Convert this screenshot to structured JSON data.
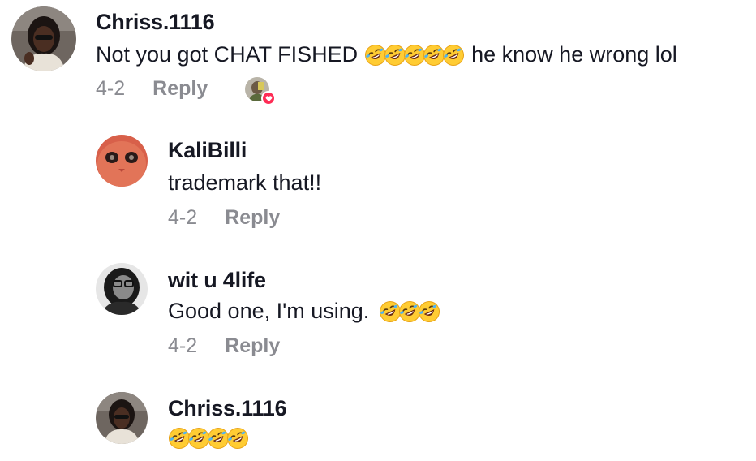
{
  "comments": [
    {
      "username": "Chriss.1116",
      "text": "Not you got CHAT FISHED",
      "emoji_count": 5,
      "text_after": "he know he wrong lol",
      "date": "4-2",
      "reply_label": "Reply"
    },
    {
      "username": "KaliBilli",
      "text": "trademark that!!",
      "date": "4-2",
      "reply_label": "Reply"
    },
    {
      "username": "wit u 4life",
      "text": "Good one, I'm using.",
      "emoji_count": 3,
      "date": "4-2",
      "reply_label": "Reply"
    },
    {
      "username": "Chriss.1116",
      "emoji_count": 4
    }
  ],
  "icons": {
    "emoji": "rolling-on-floor-laughing-emoji",
    "liked_by_creator": "heart-icon"
  },
  "colors": {
    "username": "#161823",
    "meta": "#8a8b91",
    "heart_badge": "#fe2c55"
  }
}
